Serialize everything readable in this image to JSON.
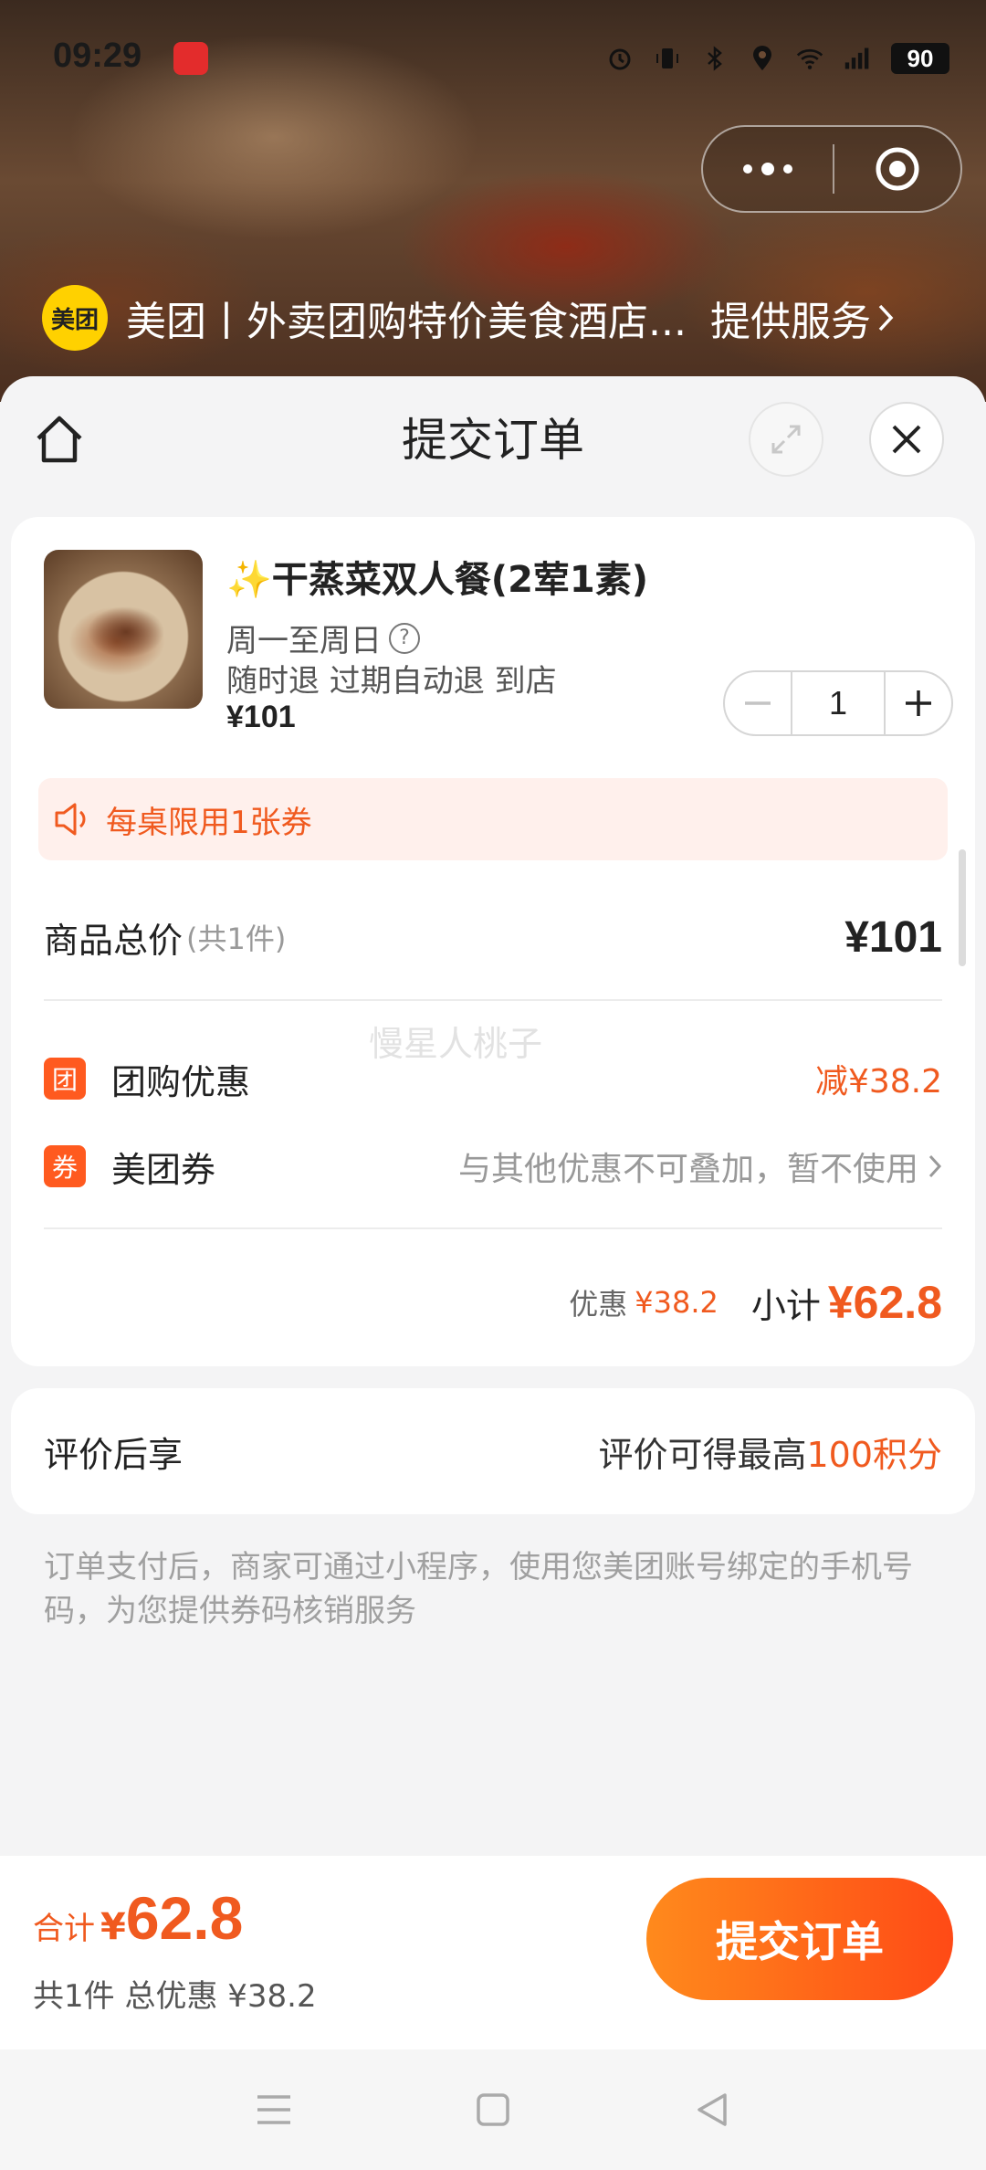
{
  "status_bar": {
    "time": "09:29",
    "battery": "90"
  },
  "capsule": {
    "more_icon": "more-dots-icon",
    "close_icon": "target-close-icon"
  },
  "mini_program": {
    "logo_text": "美团",
    "title": "美团丨外卖团购特价美食酒店...",
    "service_label": "提供服务"
  },
  "sheet": {
    "title": "提交订单"
  },
  "product": {
    "name": "✨干蒸菜双人餐(2荤1素)",
    "validity": "周一至周日",
    "policy": "随时退 过期自动退 到店",
    "price": "¥101",
    "quantity": "1"
  },
  "notice": {
    "text": "每桌限用1张券"
  },
  "summary": {
    "total_label": "商品总价",
    "total_count": "(共1件)",
    "total_value": "¥101",
    "group_discount_tag": "团",
    "group_discount_label": "团购优惠",
    "group_discount_value": "减¥38.2",
    "coupon_tag": "券",
    "coupon_label": "美团券",
    "coupon_note": "与其他优惠不可叠加，暂不使用",
    "discount_label": "优惠",
    "discount_value": "¥38.2",
    "subtotal_label": "小计",
    "subtotal_value": "¥62.8"
  },
  "review": {
    "label": "评价后享",
    "text": "评价可得最高",
    "points": "100积分"
  },
  "footnote": "订单支付后，商家可通过小程序，使用您美团账号绑定的手机号码，为您提供券码核销服务",
  "watermark": "慢星人桃子",
  "bottom": {
    "grand_label": "合计",
    "grand_currency": "¥",
    "grand_value": "62.8",
    "grand_sub": "共1件 总优惠 ¥38.2",
    "submit_label": "提交订单"
  },
  "colors": {
    "accent": "#f05a1f",
    "button_start": "#ff8a1c",
    "button_end": "#ff4a16",
    "meituan_yellow": "#ffd100"
  }
}
